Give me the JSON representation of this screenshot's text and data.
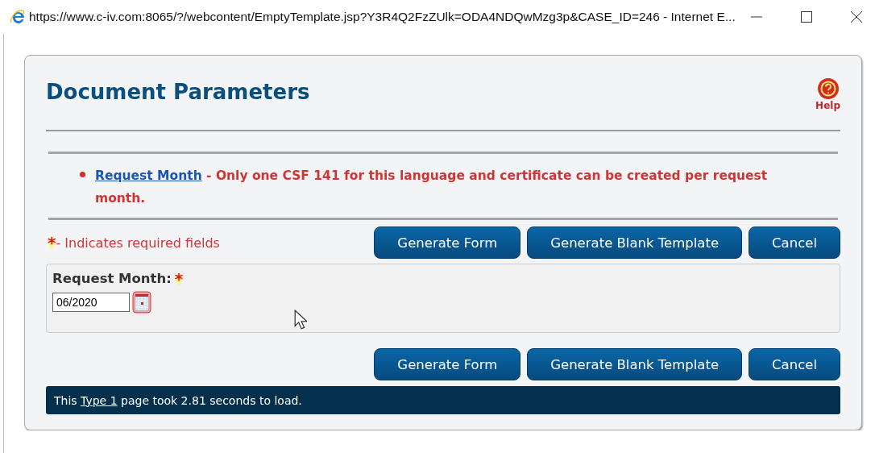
{
  "window": {
    "title": "https://www.c-iv.com:8065/?/webcontent/EmptyTemplate.jsp?Y3R4Q2FzZUlk=ODA4NDQwMzg3p&CASE_ID=246 - Internet E..."
  },
  "page": {
    "title": "Document Parameters",
    "help_label": "Help"
  },
  "errors": [
    {
      "link": "Request Month",
      "message": " - Only one CSF 141 for this language and certificate can be created per request month."
    }
  ],
  "required_note": {
    "mark": "*",
    "text": "- Indicates required fields"
  },
  "buttons_top": [
    "Generate Form",
    "Generate Blank Template",
    "Cancel"
  ],
  "fields": [
    {
      "label": "Request Month:",
      "required": true,
      "value": "06/2020"
    }
  ],
  "buttons_bottom": [
    "Generate Form",
    "Generate Blank Template",
    "Cancel"
  ],
  "status_bar": {
    "before": "This ",
    "link": "Type 1",
    "after": " page took 2.81 seconds to load."
  }
}
